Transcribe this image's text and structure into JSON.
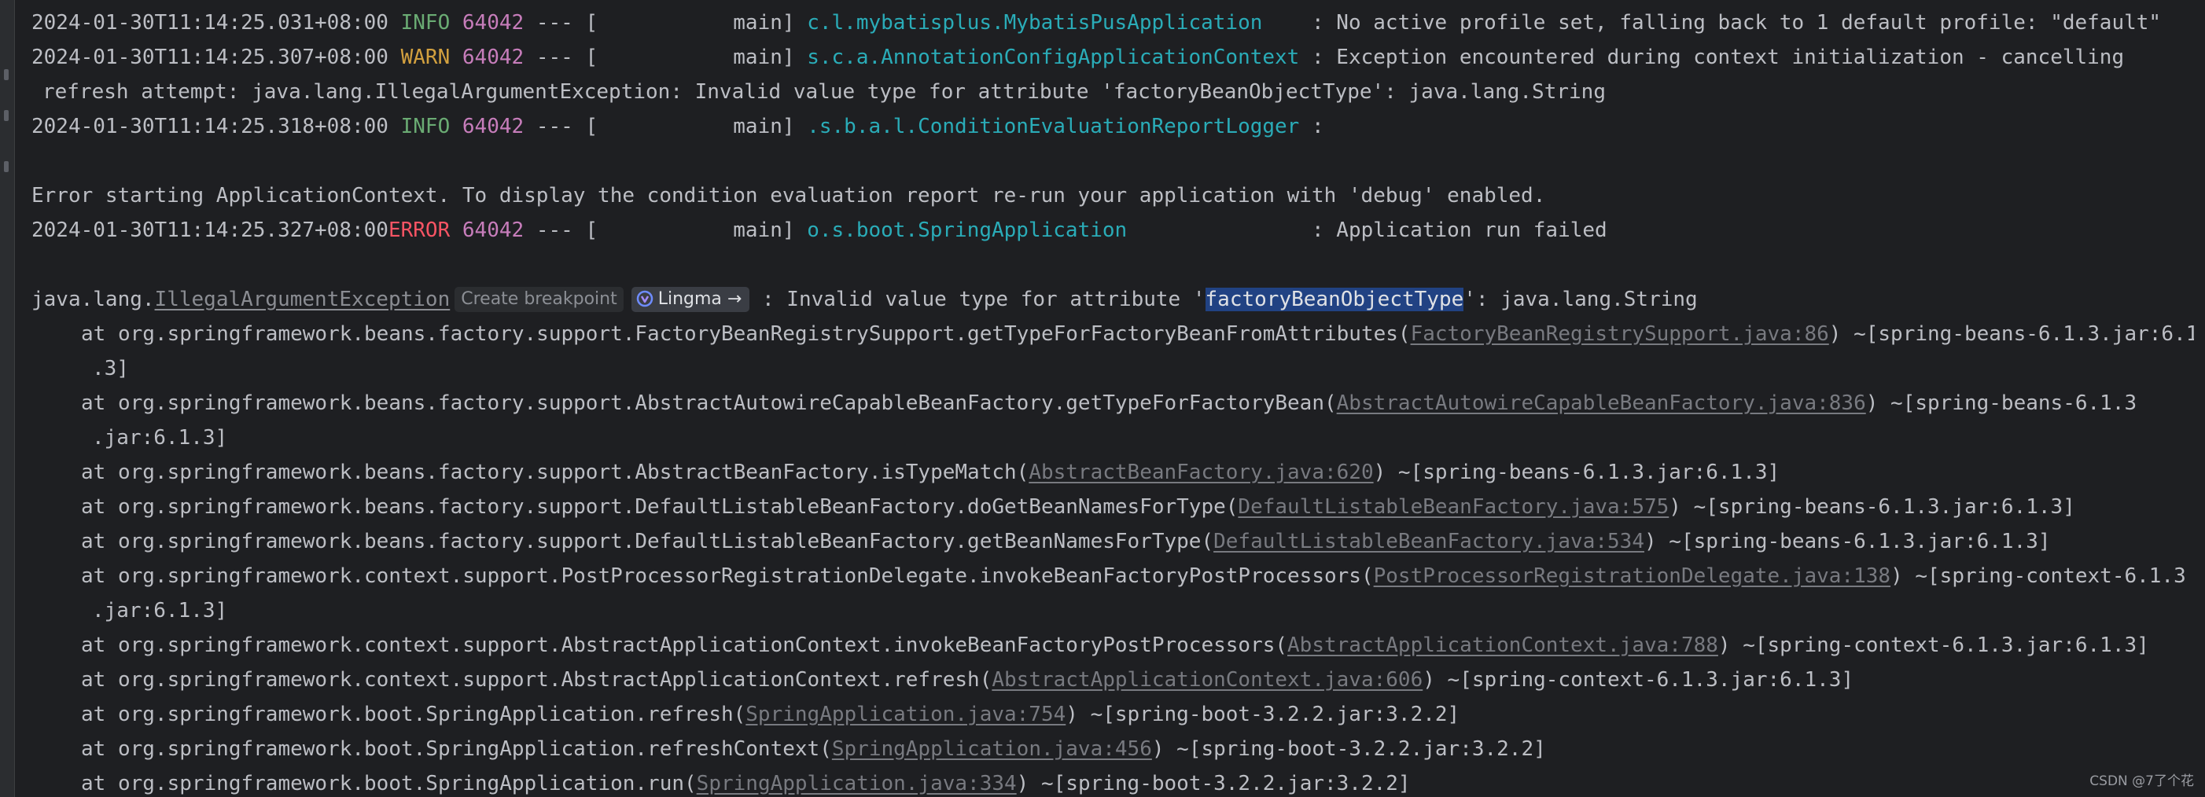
{
  "log": [
    {
      "ts": "2024-01-30T11:14:25.031+08:00",
      "level": " INFO",
      "pid": "64042",
      "sep": " --- [           main] ",
      "logger": "c.l.mybatisplus.MybatisPusApplication   ",
      "msg": " : No active profile set, falling back to 1 default profile: \"default\""
    },
    {
      "ts": "2024-01-30T11:14:25.307+08:00",
      "level": " WARN",
      "pid": "64042",
      "sep": " --- [           main] ",
      "logger": "s.c.a.AnnotationConfigApplicationContext",
      "msg": " : Exception encountered during context initialization - cancelling",
      "cont": "refresh attempt: java.lang.IllegalArgumentException: Invalid value type for attribute 'factoryBeanObjectType': java.lang.String"
    },
    {
      "ts": "2024-01-30T11:14:25.318+08:00",
      "level": " INFO",
      "pid": "64042",
      "sep": " --- [           main] ",
      "logger": ".s.b.a.l.ConditionEvaluationReportLogger",
      "msg": " :"
    },
    {
      "plain": "Error starting ApplicationContext. To display the condition evaluation report re-run your application with 'debug' enabled."
    },
    {
      "ts": "2024-01-30T11:14:25.327+08:00",
      "level": "ERROR",
      "pid": "64042",
      "sep": " --- [           main] ",
      "logger": "o.s.boot.SpringApplication              ",
      "msg": " : Application run failed"
    }
  ],
  "exception": {
    "prefix": "java.lang.",
    "link": "IllegalArgumentException",
    "breakpoint": "Create breakpoint",
    "lingma": "Lingma →",
    "msg_before": " : Invalid value type for attribute '",
    "highlight": "factoryBeanObjectType",
    "msg_after": "': java.lang.String"
  },
  "stack": [
    {
      "at": "at org.springframework.beans.factory.support.FactoryBeanRegistrySupport.getTypeForFactoryBeanFromAttributes(",
      "src": "FactoryBeanRegistrySupport.java:86",
      "jar": ") ~[spring-beans-6.1.3.jar:6.1",
      "cont": ".3]"
    },
    {
      "at": "at org.springframework.beans.factory.support.AbstractAutowireCapableBeanFactory.getTypeForFactoryBean(",
      "src": "AbstractAutowireCapableBeanFactory.java:836",
      "jar": ") ~[spring-beans-6.1.3",
      "cont": ".jar:6.1.3]"
    },
    {
      "at": "at org.springframework.beans.factory.support.AbstractBeanFactory.isTypeMatch(",
      "src": "AbstractBeanFactory.java:620",
      "jar": ") ~[spring-beans-6.1.3.jar:6.1.3]"
    },
    {
      "at": "at org.springframework.beans.factory.support.DefaultListableBeanFactory.doGetBeanNamesForType(",
      "src": "DefaultListableBeanFactory.java:575",
      "jar": ") ~[spring-beans-6.1.3.jar:6.1.3]"
    },
    {
      "at": "at org.springframework.beans.factory.support.DefaultListableBeanFactory.getBeanNamesForType(",
      "src": "DefaultListableBeanFactory.java:534",
      "jar": ") ~[spring-beans-6.1.3.jar:6.1.3]"
    },
    {
      "at": "at org.springframework.context.support.PostProcessorRegistrationDelegate.invokeBeanFactoryPostProcessors(",
      "src": "PostProcessorRegistrationDelegate.java:138",
      "jar": ") ~[spring-context-6.1.3",
      "cont": ".jar:6.1.3]"
    },
    {
      "at": "at org.springframework.context.support.AbstractApplicationContext.invokeBeanFactoryPostProcessors(",
      "src": "AbstractApplicationContext.java:788",
      "jar": ") ~[spring-context-6.1.3.jar:6.1.3]"
    },
    {
      "at": "at org.springframework.context.support.AbstractApplicationContext.refresh(",
      "src": "AbstractApplicationContext.java:606",
      "jar": ") ~[spring-context-6.1.3.jar:6.1.3]"
    },
    {
      "at": "at org.springframework.boot.SpringApplication.refresh(",
      "src": "SpringApplication.java:754",
      "jar": ") ~[spring-boot-3.2.2.jar:3.2.2]"
    },
    {
      "at": "at org.springframework.boot.SpringApplication.refreshContext(",
      "src": "SpringApplication.java:456",
      "jar": ") ~[spring-boot-3.2.2.jar:3.2.2]"
    },
    {
      "at": "at org.springframework.boot.SpringApplication.run(",
      "src": "SpringApplication.java:334",
      "jar": ") ~[spring-boot-3.2.2.jar:3.2.2]"
    }
  ],
  "watermark": "CSDN @7了个花",
  "colors": {
    "background": "#1e1f22",
    "info": "#6aab73",
    "warn": "#d2a03f",
    "error": "#f75464",
    "pid": "#c77dbb",
    "logger": "#2aacb8",
    "highlight": "#214283"
  }
}
